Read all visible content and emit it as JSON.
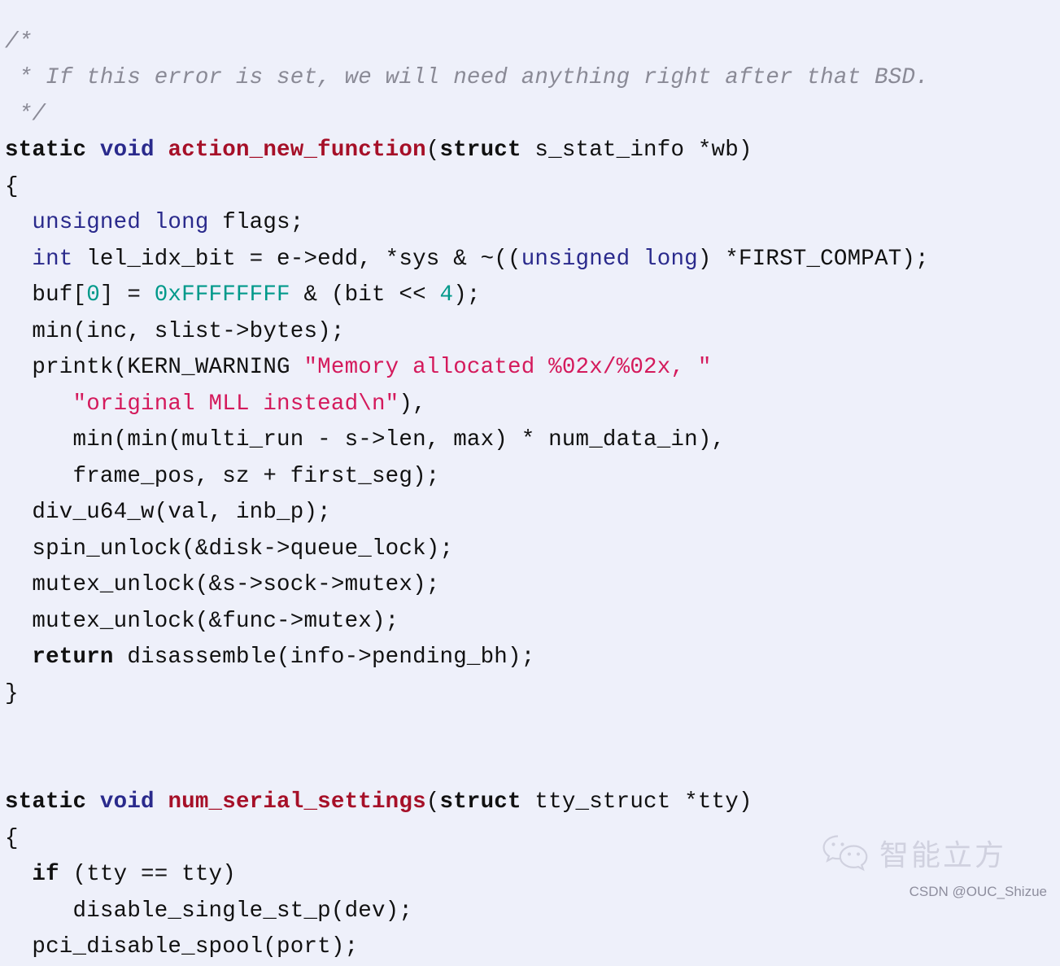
{
  "theme": {
    "background": "#eef0fa",
    "foreground": "#111111",
    "comment_color": "#8a8a96",
    "keyword_color": "#111111",
    "type_color": "#2a2a8c",
    "function_color": "#a61028",
    "string_color": "#d41a5c",
    "number_color": "#00998a"
  },
  "code": {
    "language": "c",
    "lines": [
      {
        "id": "l1",
        "indent": 0,
        "tokens": [
          {
            "t": "cmt",
            "v": "/*"
          }
        ]
      },
      {
        "id": "l2",
        "indent": 0,
        "tokens": [
          {
            "t": "cmt",
            "v": " * If this error is set, we will need anything right after that BSD."
          }
        ]
      },
      {
        "id": "l3",
        "indent": 0,
        "tokens": [
          {
            "t": "cmt",
            "v": " */"
          }
        ]
      },
      {
        "id": "l4",
        "indent": 0,
        "tokens": [
          {
            "t": "kw",
            "v": "static"
          },
          {
            "t": "pln",
            "v": " "
          },
          {
            "t": "typ",
            "v": "void"
          },
          {
            "t": "pln",
            "v": " "
          },
          {
            "t": "fn",
            "v": "action_new_function"
          },
          {
            "t": "pln",
            "v": "("
          },
          {
            "t": "kw",
            "v": "struct"
          },
          {
            "t": "pln",
            "v": " s_stat_info *wb)"
          }
        ]
      },
      {
        "id": "l5",
        "indent": 0,
        "tokens": [
          {
            "t": "pln",
            "v": "{"
          }
        ]
      },
      {
        "id": "l6",
        "indent": 0,
        "tokens": [
          {
            "t": "pln",
            "v": "  "
          },
          {
            "t": "typ-n",
            "v": "unsigned long"
          },
          {
            "t": "pln",
            "v": " flags;"
          }
        ]
      },
      {
        "id": "l7",
        "indent": 0,
        "tokens": [
          {
            "t": "pln",
            "v": "  "
          },
          {
            "t": "typ-n",
            "v": "int"
          },
          {
            "t": "pln",
            "v": " lel_idx_bit = e->edd, *sys & ~(("
          },
          {
            "t": "typ-n",
            "v": "unsigned long"
          },
          {
            "t": "pln",
            "v": ") *FIRST_COMPAT);"
          }
        ]
      },
      {
        "id": "l8",
        "indent": 0,
        "tokens": [
          {
            "t": "pln",
            "v": "  buf["
          },
          {
            "t": "num",
            "v": "0"
          },
          {
            "t": "pln",
            "v": "] = "
          },
          {
            "t": "num",
            "v": "0xFFFFFFFF"
          },
          {
            "t": "pln",
            "v": " & (bit << "
          },
          {
            "t": "num",
            "v": "4"
          },
          {
            "t": "pln",
            "v": ");"
          }
        ]
      },
      {
        "id": "l9",
        "indent": 0,
        "tokens": [
          {
            "t": "pln",
            "v": "  min(inc, slist->bytes);"
          }
        ]
      },
      {
        "id": "l10",
        "indent": 0,
        "tokens": [
          {
            "t": "pln",
            "v": "  printk(KERN_WARNING "
          },
          {
            "t": "str",
            "v": "\"Memory allocated %02x/%02x, \""
          }
        ]
      },
      {
        "id": "l11",
        "indent": 0,
        "tokens": [
          {
            "t": "pln",
            "v": "     "
          },
          {
            "t": "str",
            "v": "\"original MLL instead\\n\""
          },
          {
            "t": "pln",
            "v": "),"
          }
        ]
      },
      {
        "id": "l12",
        "indent": 0,
        "tokens": [
          {
            "t": "pln",
            "v": "     min(min(multi_run - s->len, max) * num_data_in),"
          }
        ]
      },
      {
        "id": "l13",
        "indent": 0,
        "tokens": [
          {
            "t": "pln",
            "v": "     frame_pos, sz + first_seg);"
          }
        ]
      },
      {
        "id": "l14",
        "indent": 0,
        "tokens": [
          {
            "t": "pln",
            "v": "  div_u64_w(val, inb_p);"
          }
        ]
      },
      {
        "id": "l15",
        "indent": 0,
        "tokens": [
          {
            "t": "pln",
            "v": "  spin_unlock(&disk->queue_lock);"
          }
        ]
      },
      {
        "id": "l16",
        "indent": 0,
        "tokens": [
          {
            "t": "pln",
            "v": "  mutex_unlock(&s->sock->mutex);"
          }
        ]
      },
      {
        "id": "l17",
        "indent": 0,
        "tokens": [
          {
            "t": "pln",
            "v": "  mutex_unlock(&func->mutex);"
          }
        ]
      },
      {
        "id": "l18",
        "indent": 0,
        "tokens": [
          {
            "t": "pln",
            "v": "  "
          },
          {
            "t": "kw",
            "v": "return"
          },
          {
            "t": "pln",
            "v": " disassemble(info->pending_bh);"
          }
        ]
      },
      {
        "id": "l19",
        "indent": 0,
        "tokens": [
          {
            "t": "pln",
            "v": "}"
          }
        ]
      },
      {
        "id": "l20",
        "indent": 0,
        "tokens": [
          {
            "t": "pln",
            "v": ""
          }
        ]
      },
      {
        "id": "l21",
        "indent": 0,
        "tokens": [
          {
            "t": "pln",
            "v": ""
          }
        ]
      },
      {
        "id": "l22",
        "indent": 0,
        "tokens": [
          {
            "t": "kw",
            "v": "static"
          },
          {
            "t": "pln",
            "v": " "
          },
          {
            "t": "typ",
            "v": "void"
          },
          {
            "t": "pln",
            "v": " "
          },
          {
            "t": "fn",
            "v": "num_serial_settings"
          },
          {
            "t": "pln",
            "v": "("
          },
          {
            "t": "kw",
            "v": "struct"
          },
          {
            "t": "pln",
            "v": " tty_struct *tty)"
          }
        ]
      },
      {
        "id": "l23",
        "indent": 0,
        "tokens": [
          {
            "t": "pln",
            "v": "{"
          }
        ]
      },
      {
        "id": "l24",
        "indent": 0,
        "tokens": [
          {
            "t": "pln",
            "v": "  "
          },
          {
            "t": "kw",
            "v": "if"
          },
          {
            "t": "pln",
            "v": " (tty == tty)"
          }
        ]
      },
      {
        "id": "l25",
        "indent": 0,
        "tokens": [
          {
            "t": "pln",
            "v": "     disable_single_st_p(dev);"
          }
        ]
      },
      {
        "id": "l26",
        "indent": 0,
        "tokens": [
          {
            "t": "pln",
            "v": "  pci_disable_spool(port);"
          }
        ]
      }
    ]
  },
  "watermark": {
    "icon_name": "wechat-icon",
    "brand_cn": "智能立方",
    "credit": "CSDN @OUC_Shizue"
  }
}
